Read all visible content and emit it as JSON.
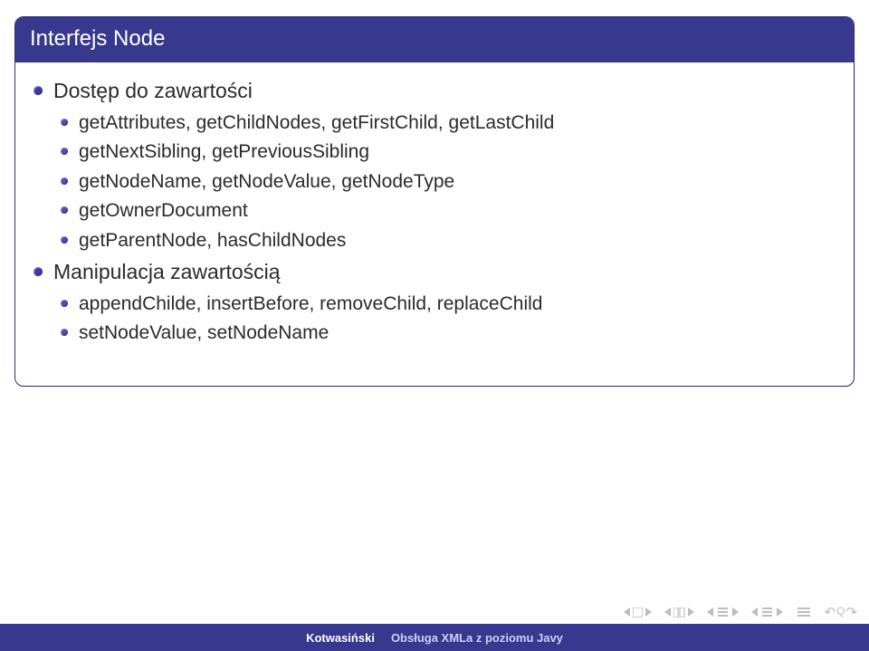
{
  "block": {
    "title": "Interfejs Node",
    "sections": [
      {
        "label": "Dostęp do zawartości",
        "items": [
          "getAttributes, getChildNodes, getFirstChild, getLastChild",
          "getNextSibling, getPreviousSibling",
          "getNodeName, getNodeValue, getNodeType",
          "getOwnerDocument",
          "getParentNode, hasChildNodes"
        ]
      },
      {
        "label": "Manipulacja zawartością",
        "items": [
          "appendChilde, insertBefore, removeChild, replaceChild",
          "setNodeValue, setNodeName"
        ]
      }
    ]
  },
  "footer": {
    "author": "Kotwasiński",
    "title": "Obsługa XMLa z poziomu Javy"
  }
}
